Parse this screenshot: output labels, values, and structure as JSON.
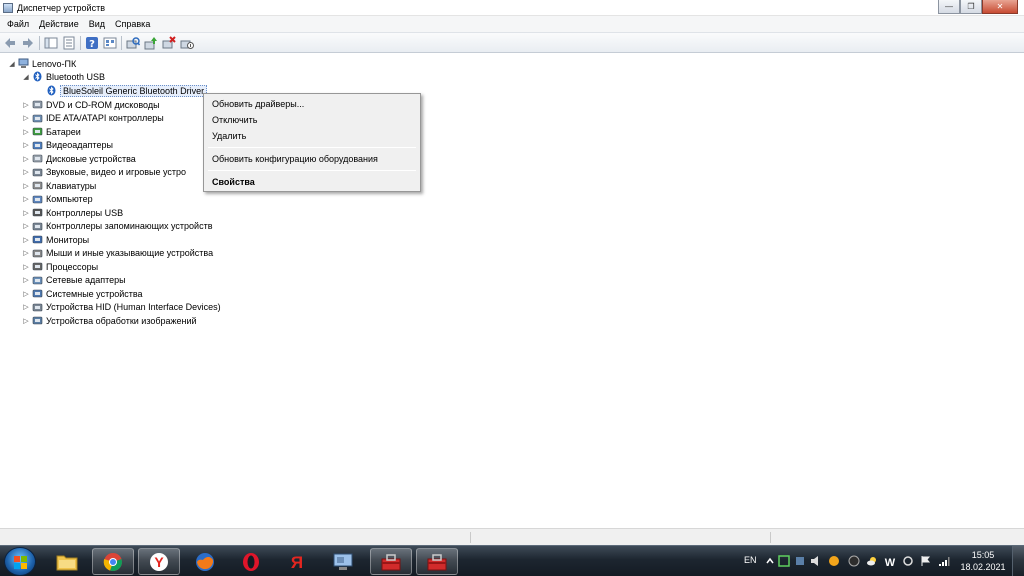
{
  "window": {
    "title": "Диспетчер устройств"
  },
  "menu": [
    {
      "label": "Файл"
    },
    {
      "label": "Действие"
    },
    {
      "label": "Вид"
    },
    {
      "label": "Справка"
    }
  ],
  "toolbar": {
    "buttons": [
      "back-icon",
      "forward-icon",
      "console-tree-icon",
      "properties-icon",
      "help-icon",
      "view-icon",
      "scan-hardware-icon",
      "update-driver-icon",
      "uninstall-icon",
      "disable-icon"
    ]
  },
  "tree": {
    "root": "Lenovo-ПК",
    "bluetooth_category": "Bluetooth USB",
    "bluetooth_device": "BlueSoleil Generic Bluetooth Driver",
    "categories": [
      {
        "label": "DVD и CD-ROM дисководы",
        "icon": "dvd-icon"
      },
      {
        "label": "IDE ATA/ATAPI контроллеры",
        "icon": "ide-controller-icon"
      },
      {
        "label": "Батареи",
        "icon": "battery-icon"
      },
      {
        "label": "Видеоадаптеры",
        "icon": "display-adapter-icon"
      },
      {
        "label": "Дисковые устройства",
        "icon": "disk-drive-icon"
      },
      {
        "label": "Звуковые, видео и игровые устро",
        "icon": "sound-icon"
      },
      {
        "label": "Клавиатуры",
        "icon": "keyboard-icon"
      },
      {
        "label": "Компьютер",
        "icon": "computer-icon"
      },
      {
        "label": "Контроллеры USB",
        "icon": "usb-icon"
      },
      {
        "label": "Контроллеры запоминающих устройств",
        "icon": "storage-controller-icon"
      },
      {
        "label": "Мониторы",
        "icon": "monitor-icon"
      },
      {
        "label": "Мыши и иные указывающие устройства",
        "icon": "mouse-icon"
      },
      {
        "label": "Процессоры",
        "icon": "processor-icon"
      },
      {
        "label": "Сетевые адаптеры",
        "icon": "network-adapter-icon"
      },
      {
        "label": "Системные устройства",
        "icon": "system-devices-icon"
      },
      {
        "label": "Устройства HID (Human Interface Devices)",
        "icon": "hid-icon"
      },
      {
        "label": "Устройства обработки изображений",
        "icon": "imaging-device-icon"
      }
    ]
  },
  "context_menu": {
    "update_drivers": "Обновить драйверы...",
    "disable": "Отключить",
    "uninstall": "Удалить",
    "scan_hardware": "Обновить конфигурацию оборудования",
    "properties": "Свойства"
  },
  "taskbar": {
    "apps": [
      "file-explorer-icon",
      "chrome-icon",
      "yandex-icon",
      "firefox-icon",
      "opera-icon",
      "yandex-browser-icon",
      "device-manager-icon",
      "toolbox-icon",
      "toolbox-icon"
    ],
    "language": "EN",
    "time": "15:05",
    "date": "18.02.2021"
  },
  "colors": {
    "accent": "#1c5fa8",
    "taskbar": "#1d2630",
    "selection": "#e6eefb"
  }
}
